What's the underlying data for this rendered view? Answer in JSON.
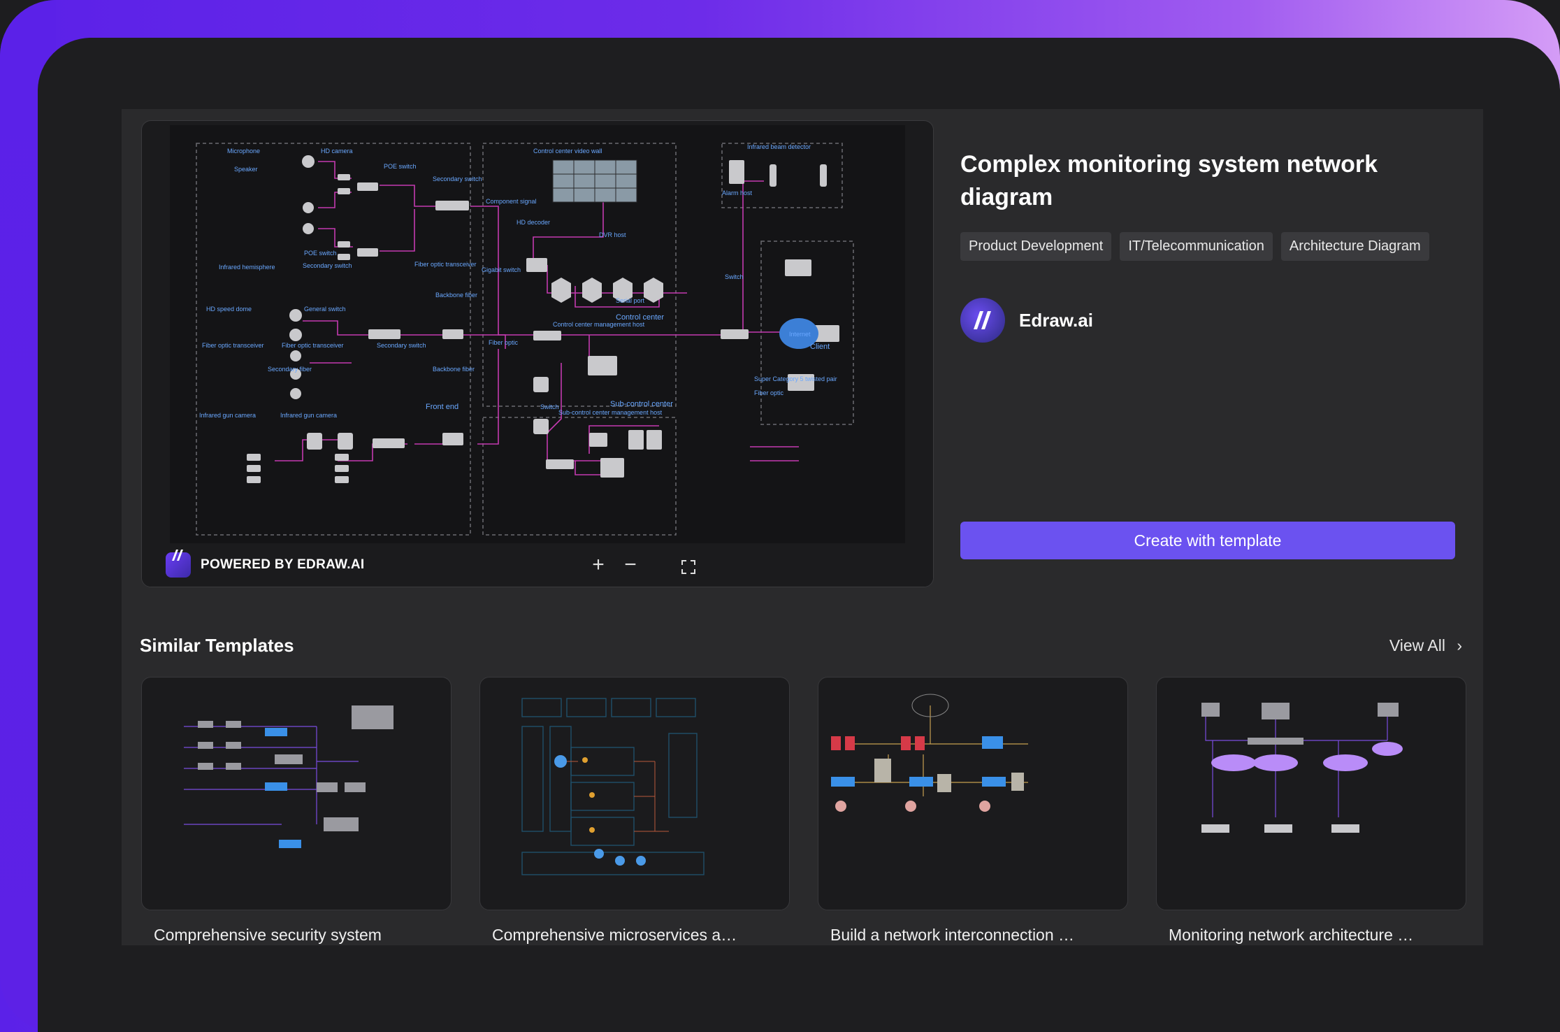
{
  "template": {
    "title": "Complex monitoring system network diagram",
    "tags": [
      "Product Development",
      "IT/Telecommunication",
      "Architecture Diagram"
    ],
    "author": "Edraw.ai",
    "create_label": "Create with template"
  },
  "preview": {
    "powered_label": "POWERED BY EDRAW.AI",
    "zoom_in_icon": "plus-icon",
    "zoom_out_icon": "minus-icon",
    "fullscreen_icon": "expand-icon",
    "diagram_labels": {
      "microphone": "Microphone",
      "hd_camera": "HD camera",
      "speaker": "Speaker",
      "poe_switch": "POE switch",
      "secondary_switch": "Secondary switch",
      "control_center_video_wall": "Control center video wall",
      "infrared_beam_detector": "Infrared beam detector",
      "alarm_host": "Alarm host",
      "component_signal": "Component signal",
      "hd_decoder": "HD decoder",
      "dvr_host": "DVR host",
      "infrared_hemisphere": "Infrared hemisphere",
      "fiber_optic_transceiver": "Fiber optic transceiver",
      "backbone_fiber": "Backbone fiber",
      "gigabit_switch": "Gigabit switch",
      "switch": "Switch",
      "internet": "Internet",
      "hd_speed_dome": "HD speed dome",
      "general_switch": "General switch",
      "serial_port": "Serial port",
      "control_center": "Control center",
      "control_center_management_host": "Control center management host",
      "client": "Client",
      "fiber_optic": "Fiber optic",
      "secondary_fiber": "Secondary fiber",
      "super_cat5": "Super Category 5 twisted pair",
      "infrared_gun_camera": "Infrared gun camera",
      "front_end": "Front end",
      "sub_control_center": "Sub-control center",
      "sub_control_host": "Sub-control center management host"
    }
  },
  "similar": {
    "title": "Similar Templates",
    "view_all": "View All",
    "items": [
      {
        "title": "Comprehensive security system"
      },
      {
        "title": "Comprehensive microservices a…"
      },
      {
        "title": "Build a network interconnection …"
      },
      {
        "title": "Monitoring network architecture …"
      }
    ]
  },
  "colors": {
    "accent": "#6b52f0",
    "line": "#c43ab0",
    "label": "#6aa8ff"
  }
}
